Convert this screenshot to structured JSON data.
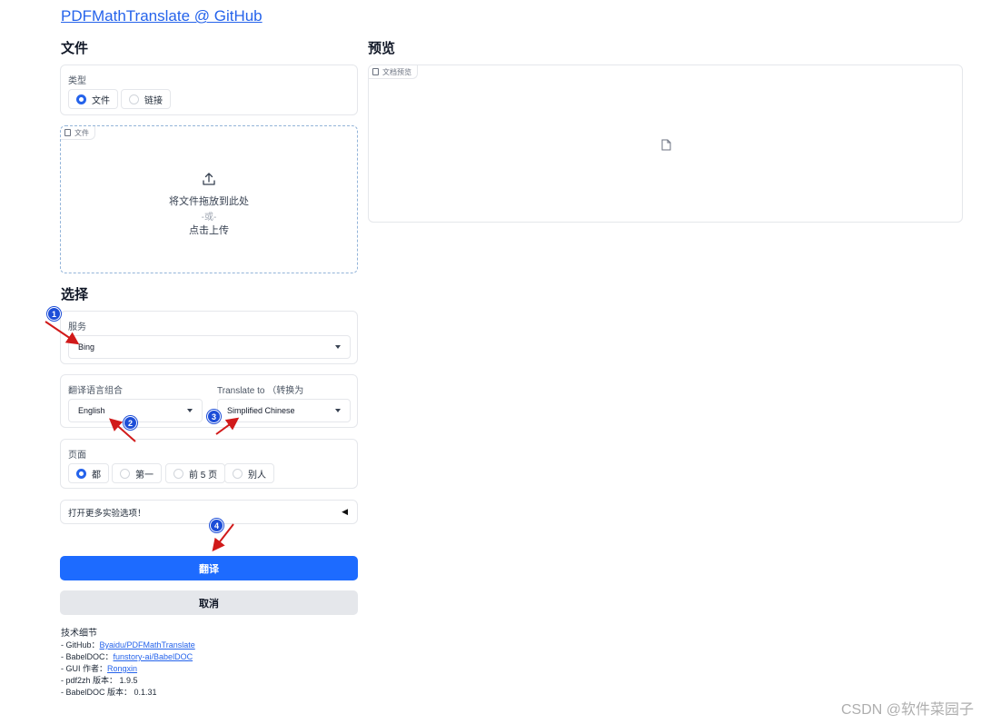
{
  "header": {
    "title": "PDFMathTranslate @ GitHub"
  },
  "file_section": {
    "title": "文件",
    "type_label": "类型",
    "type_options": [
      "文件",
      "链接"
    ],
    "upload_tag": "文件",
    "upload_text": "将文件拖放到此处",
    "upload_or": "-或-",
    "upload_click": "点击上传"
  },
  "preview_section": {
    "title": "预览",
    "tag": "文档预览"
  },
  "select_section": {
    "title": "选择",
    "service_label": "服务",
    "service_value": "Bing",
    "lang_from_label": "翻译语言组合",
    "lang_from_value": "English",
    "lang_to_label": "Translate to （转换为",
    "lang_to_value": "Simplified Chinese",
    "pages_label": "页面",
    "page_options": [
      "都",
      "第一",
      "前 5 页",
      "别人"
    ],
    "experimental": "打开更多实验选项！",
    "experimental_arrow": "◀"
  },
  "buttons": {
    "translate": "翻译",
    "cancel": "取消"
  },
  "tech": {
    "title": "技术细节",
    "github_label": "- GitHub：",
    "github_link": "Byaidu/PDFMathTranslate",
    "babeldoc_label": "- BabelDOC：",
    "babeldoc_link": "funstory-ai/BabelDOC",
    "gui_label": "- GUI 作者：",
    "gui_link": "Rongxin",
    "pdf2zh_version": "- pdf2zh 版本： 1.9.5",
    "babeldoc_version": "- BabelDOC 版本： 0.1.31"
  },
  "annotations": {
    "m1": "1",
    "m2": "2",
    "m3": "3",
    "m4": "4"
  },
  "watermark": "CSDN @软件菜园子",
  "colors": {
    "accent": "#1d6bff",
    "link": "#2563eb",
    "arrow": "#d11a1a",
    "marker": "#1d4ed8"
  }
}
